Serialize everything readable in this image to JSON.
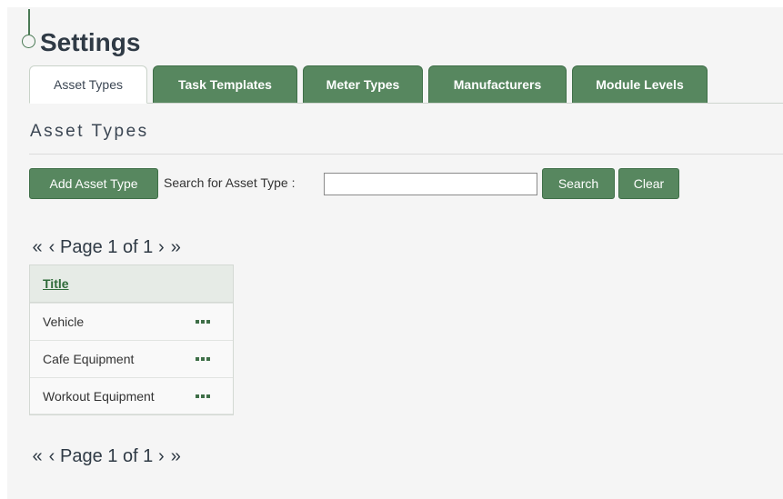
{
  "page": {
    "title": "Settings"
  },
  "tabs": [
    {
      "label": "Asset Types",
      "active": true
    },
    {
      "label": "Task Templates",
      "active": false
    },
    {
      "label": "Meter Types",
      "active": false
    },
    {
      "label": "Manufacturers",
      "active": false
    },
    {
      "label": "Module Levels",
      "active": false
    }
  ],
  "section": {
    "title": "Asset Types"
  },
  "toolbar": {
    "add_label": "Add Asset Type",
    "search_label": "Search for Asset Type :",
    "search_value": "",
    "search_button": "Search",
    "clear_button": "Clear"
  },
  "pager": {
    "first": "«",
    "prev": "‹",
    "label": "Page 1 of 1",
    "next": "›",
    "last": "»"
  },
  "table": {
    "header": "Title",
    "rows": [
      {
        "title": "Vehicle"
      },
      {
        "title": "Cafe Equipment"
      },
      {
        "title": "Workout Equipment"
      }
    ]
  },
  "colors": {
    "accent": "#57875f",
    "accent_border": "#3f6f48",
    "link": "#2f6b3a",
    "background": "#f5f5f5"
  },
  "icons": {
    "row_action": "more-dots-icon",
    "title_marker": "timeline-marker-icon"
  }
}
